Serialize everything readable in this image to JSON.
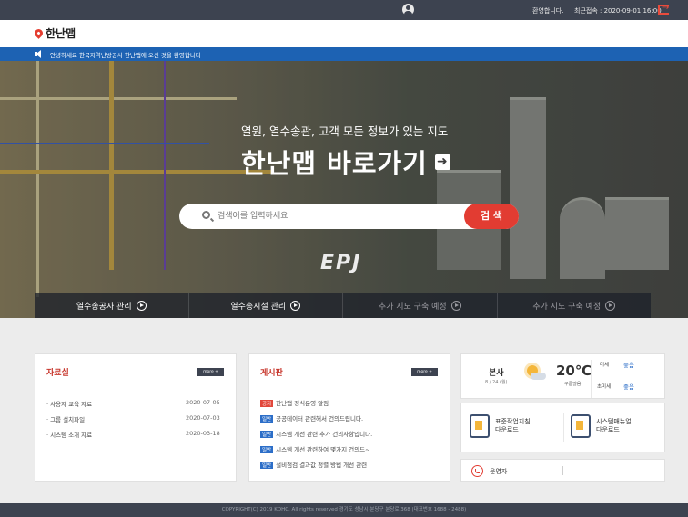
{
  "topbar": {
    "welcome": "환영합니다.",
    "last_login": "최근접속 : 2020-09-01 16:00"
  },
  "header": {
    "logo_text": "한난맵"
  },
  "notice": {
    "text": "안녕하세요 한국지역난방공사 한난맵에 오신 것을 환영합니다"
  },
  "hero": {
    "tagline": "열원, 열수송관, 고객 모든 정보가 있는 지도",
    "title": "한난맵 바로가기",
    "title_arrow": "➜",
    "search_placeholder": "검색어를 입력하세요",
    "search_button": "검 색",
    "watermark": "EPJ",
    "quicknav": [
      {
        "label": "열수송공사 관리",
        "active": true
      },
      {
        "label": "열수송시설 관리",
        "active": true
      },
      {
        "label": "추가 지도 구축 예정",
        "active": false
      },
      {
        "label": "추가 지도 구축 예정",
        "active": false
      }
    ]
  },
  "resources": {
    "title": "자료실",
    "more": "more +",
    "items": [
      {
        "title": "· 사용자 교육 자료",
        "date": "2020-07-05"
      },
      {
        "title": "· 그룹 설치파일",
        "date": "2020-07-03"
      },
      {
        "title": "· 시스템 소개 자료",
        "date": "2020-03-18"
      }
    ]
  },
  "board": {
    "title": "게시판",
    "more": "more +",
    "items": [
      {
        "tag": "공지",
        "tag_color": "#e2473b",
        "title": "한난맵 정식운영 알림"
      },
      {
        "tag": "일반",
        "tag_color": "#2c6ec8",
        "title": "공공데이터 관련해서 건의드립니다."
      },
      {
        "tag": "일반",
        "tag_color": "#2c6ec8",
        "title": "시스템 개선 관련 추가 건의사항입니다."
      },
      {
        "tag": "일반",
        "tag_color": "#2c6ec8",
        "title": "시스템 개선 관련하여 몇가지 건의드~"
      },
      {
        "tag": "일반",
        "tag_color": "#2c6ec8",
        "title": "설비점검 결과값 정렬 방법 개선 관련"
      }
    ]
  },
  "weather": {
    "location": "본사",
    "date": "8 / 24 (월)",
    "temperature": "20℃",
    "condition": "구름많음",
    "fine_dust_label": "미세",
    "fine_dust_value": "좋음",
    "ultrafine_label": "초미세",
    "ultrafine_value": "좋음"
  },
  "downloads": {
    "items": [
      {
        "line1": "표준작업지침",
        "line2": "다운로드",
        "icon": "document-download-icon"
      },
      {
        "line1": "시스템매뉴얼",
        "line2": "다운로드",
        "icon": "manual-book-icon"
      }
    ]
  },
  "operator": {
    "label": "운영자"
  },
  "footer": {
    "copyright": "COPYRIGHT(C) 2019 KDHC. All rights reserved 경기도 성남시 분당구 분당로 368 (대표번호 1688 - 2488)"
  }
}
